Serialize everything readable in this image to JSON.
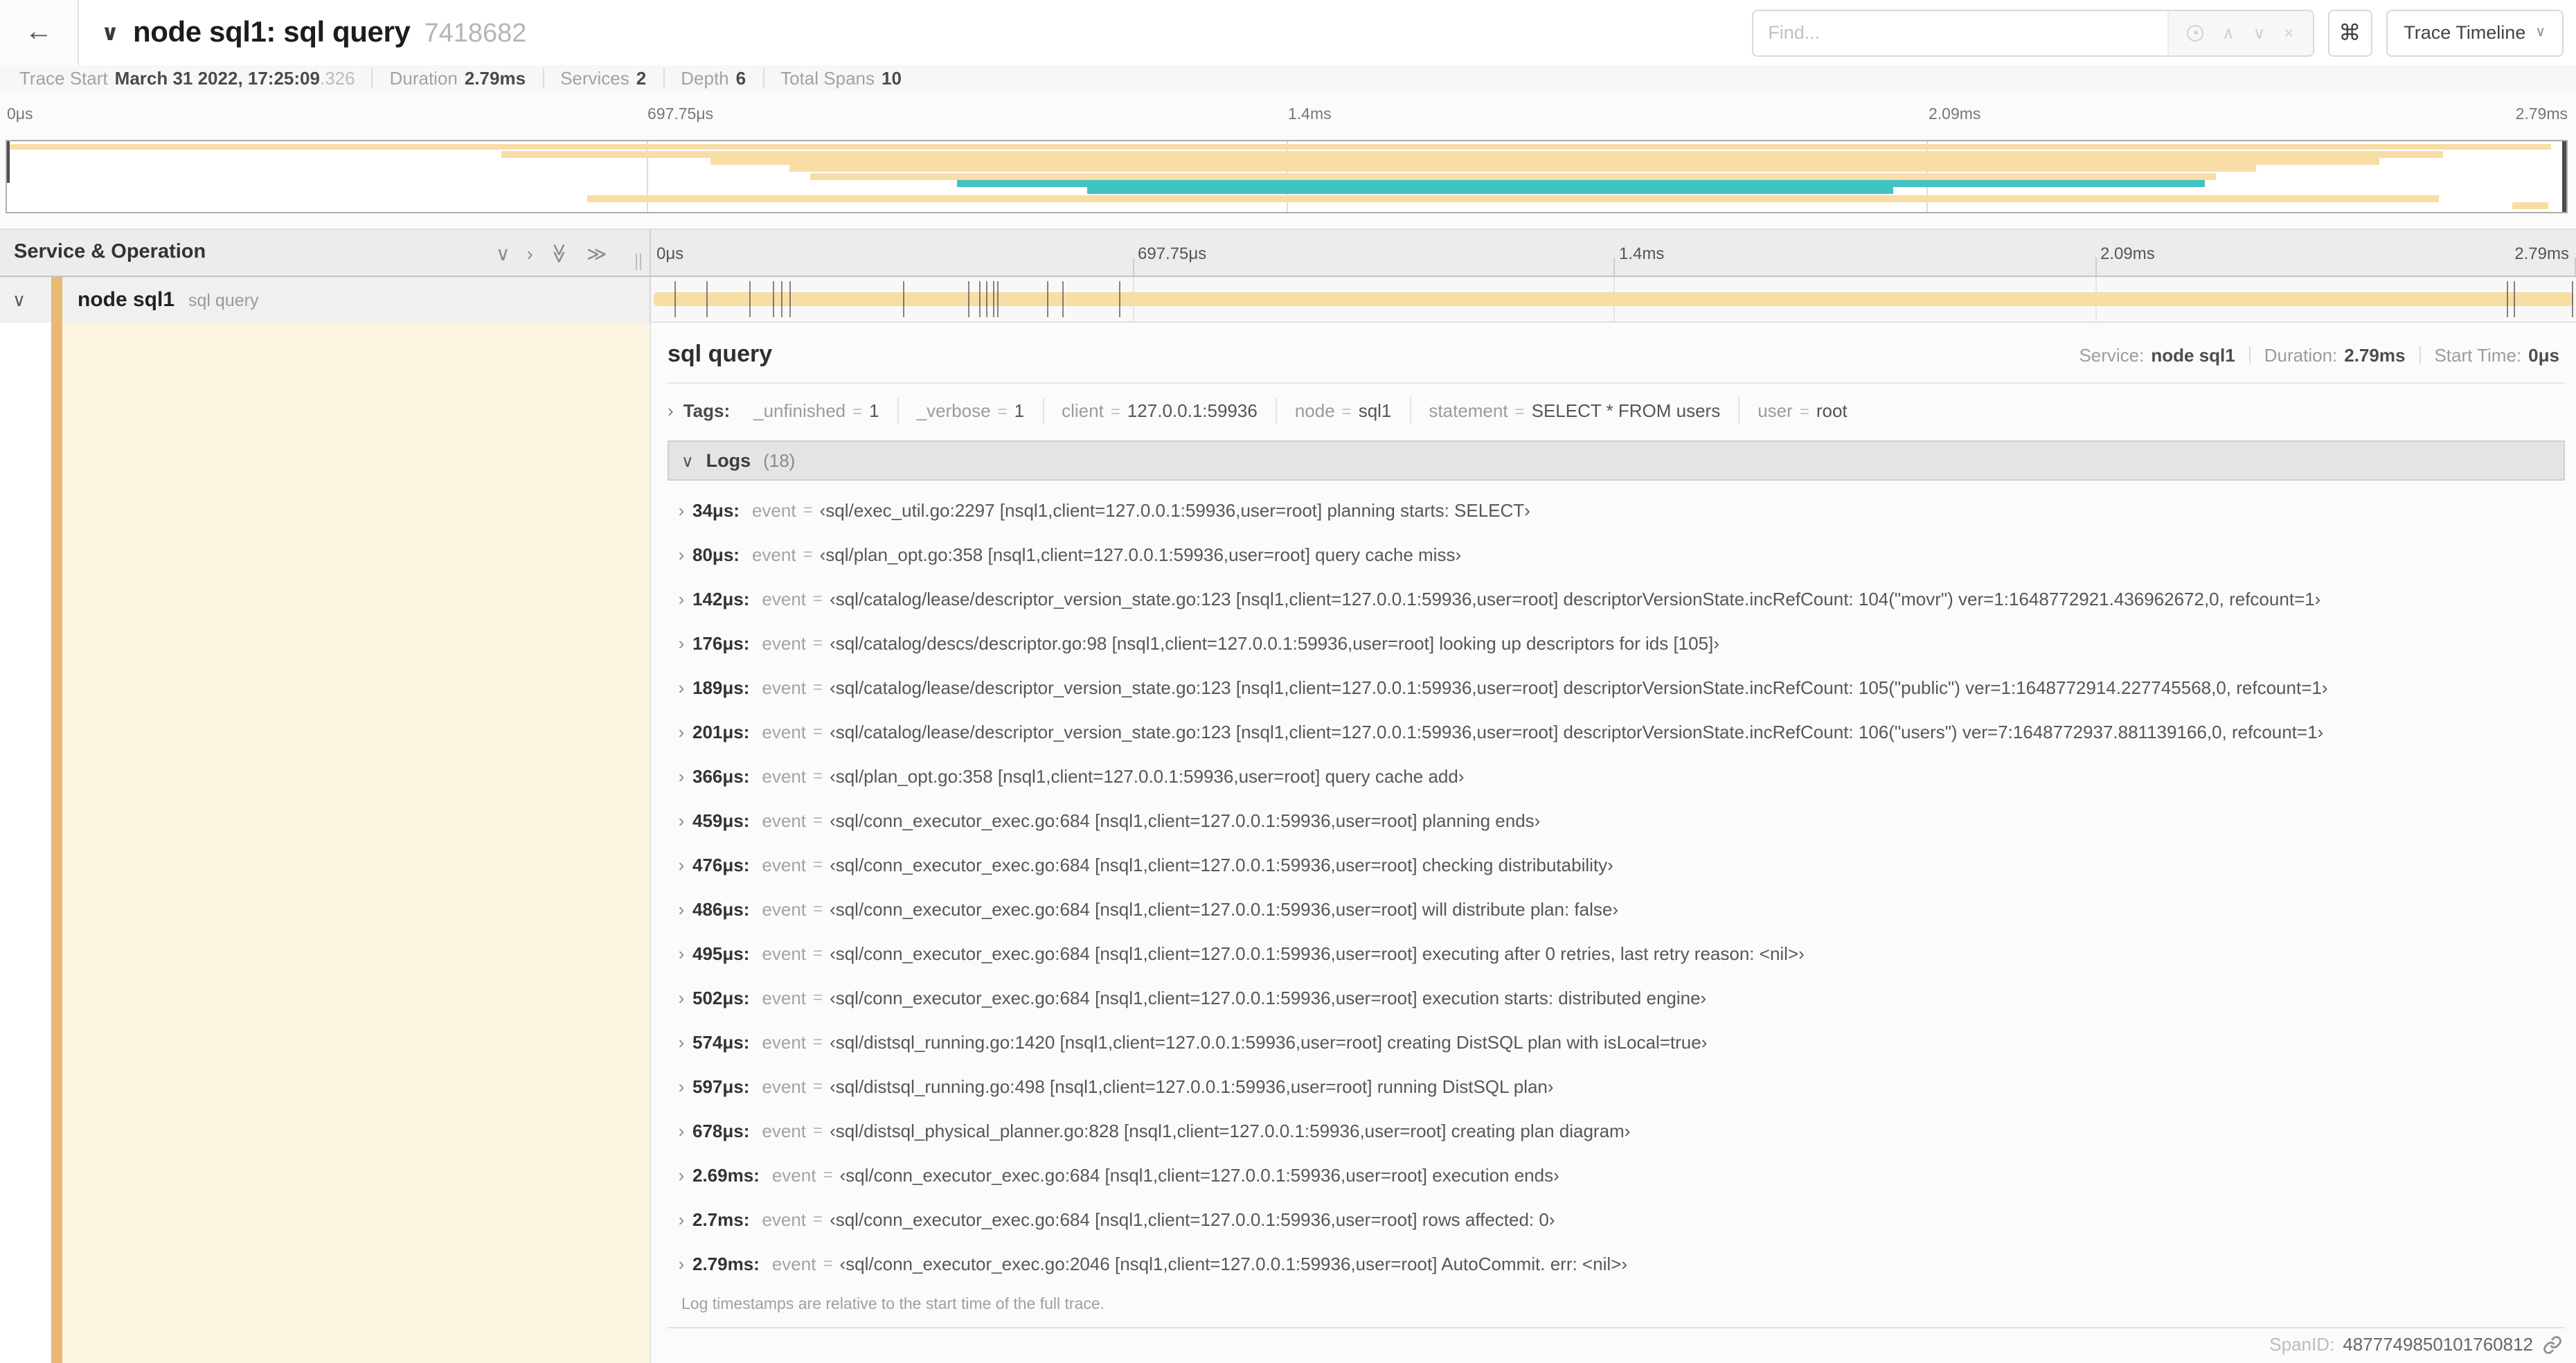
{
  "colors": {
    "tan": "#f8dda4",
    "teal": "#3fc3c3",
    "stripe": "#e9b873",
    "cream": "#fcf5e1"
  },
  "icons": {
    "back": "←",
    "chevron_down": "∨",
    "chevron_up": "∧",
    "chevron_right": "›",
    "double_chevron_right": "≫",
    "double_chevron_down": "≫",
    "command": "⌘",
    "close": "×"
  },
  "header": {
    "title": "node sql1: sql query",
    "trace_id": "7418682",
    "find_placeholder": "Find...",
    "view_dropdown": "Trace Timeline"
  },
  "summary": {
    "items": [
      {
        "label": "Trace Start",
        "value": "March 31 2022, 17:25:09",
        "suffix": ".326"
      },
      {
        "label": "Duration",
        "value": "2.79ms"
      },
      {
        "label": "Services",
        "value": "2"
      },
      {
        "label": "Depth",
        "value": "6"
      },
      {
        "label": "Total Spans",
        "value": "10"
      }
    ]
  },
  "minimap": {
    "labels": [
      {
        "label": "0μs",
        "left": "0%"
      },
      {
        "label": "697.75μs",
        "left": "25%"
      },
      {
        "label": "1.4ms",
        "left": "50%"
      },
      {
        "label": "2.09ms",
        "left": "75%"
      },
      {
        "label": "2.79ms",
        "left": "100%",
        "cls": "right"
      }
    ],
    "bars": [
      {
        "top": "3%",
        "left": "0%",
        "width": "99.4%",
        "color": "var(--tan)"
      },
      {
        "top": "13.4%",
        "left": "19.3%",
        "width": "75.9%",
        "color": "var(--tan)"
      },
      {
        "top": "23.8%",
        "left": "27.5%",
        "width": "65.2%",
        "color": "var(--tan)"
      },
      {
        "top": "34.2%",
        "left": "30.6%",
        "width": "57.3%",
        "color": "var(--tan)"
      },
      {
        "top": "44.6%",
        "left": "31.4%",
        "width": "54.9%",
        "color": "var(--tan)"
      },
      {
        "top": "55%",
        "left": "37.1%",
        "width": "48.8%",
        "color": "var(--teal)"
      },
      {
        "top": "65.4%",
        "left": "42.2%",
        "width": "31.5%",
        "color": "var(--teal)"
      },
      {
        "top": "75.8%",
        "left": "22.7%",
        "width": "72.3%",
        "color": "var(--tan)"
      },
      {
        "top": "86.2%",
        "left": "97.9%",
        "width": "1.4%",
        "color": "var(--tan)"
      }
    ]
  },
  "timeline": {
    "left_header": "Service & Operation",
    "ticks": [
      {
        "label": "0μs",
        "left": "0%",
        "line": false
      },
      {
        "label": "697.75μs",
        "left": "25%",
        "line": true
      },
      {
        "label": "1.4ms",
        "left": "50%",
        "line": true
      },
      {
        "label": "2.09ms",
        "left": "75%",
        "line": true
      },
      {
        "label": "2.79ms",
        "left": "100%",
        "line": true,
        "cls": "right"
      }
    ],
    "row": {
      "service": "node sql1",
      "operation": "sql query"
    },
    "log_markers": [
      {
        "left": "1.22%"
      },
      {
        "left": "2.87%"
      },
      {
        "left": "5.09%"
      },
      {
        "left": "6.31%"
      },
      {
        "left": "6.77%"
      },
      {
        "left": "7.2%"
      },
      {
        "left": "13.12%"
      },
      {
        "left": "16.45%"
      },
      {
        "left": "17.06%"
      },
      {
        "left": "17.42%"
      },
      {
        "left": "17.74%"
      },
      {
        "left": "18.0%"
      },
      {
        "left": "20.57%"
      },
      {
        "left": "21.4%"
      },
      {
        "left": "24.3%"
      },
      {
        "left": "96.42%"
      },
      {
        "left": "96.77%"
      },
      {
        "left": "99.8%"
      }
    ]
  },
  "detail": {
    "operation": "sql query",
    "service_label": "Service:",
    "service": "node sql1",
    "duration_label": "Duration:",
    "duration": "2.79ms",
    "start_label": "Start Time:",
    "start": "0μs",
    "tags": {
      "title": "Tags:",
      "items": [
        {
          "key": "_unfinished",
          "value": "1"
        },
        {
          "key": "_verbose",
          "value": "1"
        },
        {
          "key": "client",
          "value": "127.0.0.1:59936"
        },
        {
          "key": "node",
          "value": "sql1"
        },
        {
          "key": "statement",
          "value": "SELECT * FROM users"
        },
        {
          "key": "user",
          "value": "root"
        }
      ]
    },
    "logs": {
      "title": "Logs",
      "count": "(18)",
      "entries": [
        {
          "t": "34μs:",
          "key": "event",
          "value": "‹sql/exec_util.go:2297 [nsql1,client=127.0.0.1:59936,user=root] planning starts: SELECT›"
        },
        {
          "t": "80μs:",
          "key": "event",
          "value": "‹sql/plan_opt.go:358 [nsql1,client=127.0.0.1:59936,user=root] query cache miss›"
        },
        {
          "t": "142μs:",
          "key": "event",
          "value": "‹sql/catalog/lease/descriptor_version_state.go:123 [nsql1,client=127.0.0.1:59936,user=root] descriptorVersionState.incRefCount: 104(\"movr\") ver=1:1648772921.436962672,0, refcount=1›"
        },
        {
          "t": "176μs:",
          "key": "event",
          "value": "‹sql/catalog/descs/descriptor.go:98 [nsql1,client=127.0.0.1:59936,user=root] looking up descriptors for ids [105]›"
        },
        {
          "t": "189μs:",
          "key": "event",
          "value": "‹sql/catalog/lease/descriptor_version_state.go:123 [nsql1,client=127.0.0.1:59936,user=root] descriptorVersionState.incRefCount: 105(\"public\") ver=1:1648772914.227745568,0, refcount=1›"
        },
        {
          "t": "201μs:",
          "key": "event",
          "value": "‹sql/catalog/lease/descriptor_version_state.go:123 [nsql1,client=127.0.0.1:59936,user=root] descriptorVersionState.incRefCount: 106(\"users\") ver=7:1648772937.881139166,0, refcount=1›"
        },
        {
          "t": "366μs:",
          "key": "event",
          "value": "‹sql/plan_opt.go:358 [nsql1,client=127.0.0.1:59936,user=root] query cache add›"
        },
        {
          "t": "459μs:",
          "key": "event",
          "value": "‹sql/conn_executor_exec.go:684 [nsql1,client=127.0.0.1:59936,user=root] planning ends›"
        },
        {
          "t": "476μs:",
          "key": "event",
          "value": "‹sql/conn_executor_exec.go:684 [nsql1,client=127.0.0.1:59936,user=root] checking distributability›"
        },
        {
          "t": "486μs:",
          "key": "event",
          "value": "‹sql/conn_executor_exec.go:684 [nsql1,client=127.0.0.1:59936,user=root] will distribute plan: false›"
        },
        {
          "t": "495μs:",
          "key": "event",
          "value": "‹sql/conn_executor_exec.go:684 [nsql1,client=127.0.0.1:59936,user=root] executing after 0 retries, last retry reason: <nil>›"
        },
        {
          "t": "502μs:",
          "key": "event",
          "value": "‹sql/conn_executor_exec.go:684 [nsql1,client=127.0.0.1:59936,user=root] execution starts: distributed engine›"
        },
        {
          "t": "574μs:",
          "key": "event",
          "value": "‹sql/distsql_running.go:1420 [nsql1,client=127.0.0.1:59936,user=root] creating DistSQL plan with isLocal=true›"
        },
        {
          "t": "597μs:",
          "key": "event",
          "value": "‹sql/distsql_running.go:498 [nsql1,client=127.0.0.1:59936,user=root] running DistSQL plan›"
        },
        {
          "t": "678μs:",
          "key": "event",
          "value": "‹sql/distsql_physical_planner.go:828 [nsql1,client=127.0.0.1:59936,user=root] creating plan diagram›"
        },
        {
          "t": "2.69ms:",
          "key": "event",
          "value": "‹sql/conn_executor_exec.go:684 [nsql1,client=127.0.0.1:59936,user=root] execution ends›"
        },
        {
          "t": "2.7ms:",
          "key": "event",
          "value": "‹sql/conn_executor_exec.go:684 [nsql1,client=127.0.0.1:59936,user=root] rows affected: 0›"
        },
        {
          "t": "2.79ms:",
          "key": "event",
          "value": "‹sql/conn_executor_exec.go:2046 [nsql1,client=127.0.0.1:59936,user=root] AutoCommit. err: <nil>›"
        }
      ],
      "footer": "Log timestamps are relative to the start time of the full trace."
    },
    "span_id_label": "SpanID:",
    "span_id": "4877749850101760812"
  }
}
